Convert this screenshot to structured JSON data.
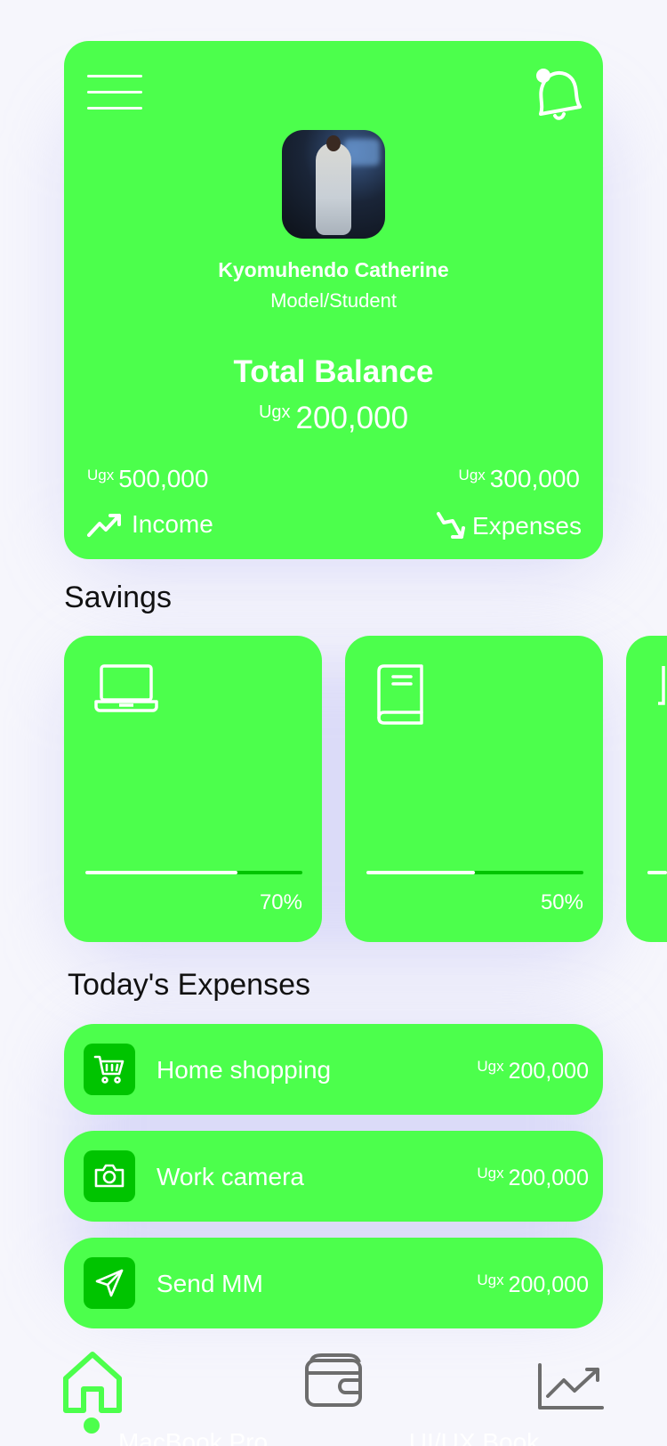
{
  "header": {
    "menu_icon": "hamburger-menu-icon",
    "bell_icon": "bell-icon"
  },
  "profile": {
    "name": "Kyomuhendo Catherine",
    "role": "Model/Student"
  },
  "balance": {
    "label": "Total Balance",
    "currency": "Ugx",
    "amount": "200,000",
    "income": {
      "currency": "Ugx",
      "amount": "500,000",
      "label": "Income"
    },
    "expenses": {
      "currency": "Ugx",
      "amount": "300,000",
      "label": "Expenses"
    }
  },
  "savings": {
    "title": "Savings",
    "items": [
      {
        "name": "MacBook Pro",
        "percent_label": "70%",
        "progress": 0.7,
        "icon": "laptop-icon"
      },
      {
        "name": "UI/UX Book",
        "percent_label": "50%",
        "progress": 0.5,
        "icon": "book-icon"
      }
    ]
  },
  "expenses": {
    "title": "Today's Expenses",
    "items": [
      {
        "name": "Home shopping",
        "currency": "Ugx",
        "amount": "200,000",
        "icon": "shopping-cart-icon"
      },
      {
        "name": "Work camera",
        "currency": "Ugx",
        "amount": "200,000",
        "icon": "camera-icon"
      },
      {
        "name": "Send MM",
        "currency": "Ugx",
        "amount": "200,000",
        "icon": "send-icon"
      }
    ]
  },
  "nav": {
    "items": [
      {
        "icon": "home-icon",
        "active": true
      },
      {
        "icon": "wallet-icon",
        "active": false
      },
      {
        "icon": "chart-trend-icon",
        "active": false
      }
    ]
  },
  "colors": {
    "accent": "#4cff4c",
    "accent_dark": "#00c400",
    "background": "#f6f6fc",
    "nav_inactive": "#6d6d6d"
  }
}
